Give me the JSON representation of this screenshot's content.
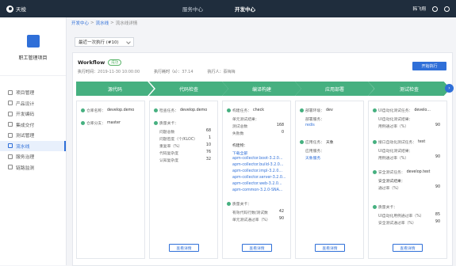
{
  "topbar": {
    "logo": "天梭",
    "nav": [
      "服务中心",
      "开发中心"
    ],
    "user": "韩飞翔"
  },
  "sidebar": {
    "project": "职工管理项目",
    "items": [
      "项目管理",
      "产品设计",
      "开发编码",
      "集成交付",
      "测试管理",
      "流水线",
      "服务治理",
      "链路监测"
    ],
    "active_index": 5
  },
  "breadcrumb": [
    "开发中心",
    "流水线",
    "流水线详情"
  ],
  "select": {
    "value": "最近一次执行 (#10)"
  },
  "workflow": {
    "title": "Workflow",
    "tag": "成功",
    "started_label": "执行时间：",
    "started": "2019-11-30 10:00:00",
    "duration_label": "执行耗时（s）：",
    "duration": "37.14",
    "executor_label": "执行人：",
    "executor": "蔡梅梅",
    "run_button": "开始执行"
  },
  "stages": [
    "源代码",
    "代码检查",
    "编译构建",
    "应用部署",
    "测试检查"
  ],
  "columns": {
    "source": {
      "repo_label": "仓库名称：",
      "repo": "develop.demo",
      "branch_label": "仓库分支：",
      "branch": "master"
    },
    "check": {
      "task_label": "检查任务：",
      "task": "develop.demo",
      "result_label": "质量关卡：",
      "metrics": [
        {
          "label": "问题总数",
          "value": "68"
        },
        {
          "label": "问题密度（个/KLOC）",
          "value": "1"
        },
        {
          "label": "重复率（%）",
          "value": "10"
        },
        {
          "label": "代码复杂度",
          "value": "76"
        },
        {
          "label": "认知复杂度",
          "value": "32"
        }
      ]
    },
    "build": {
      "task_label": "构建任务：",
      "task": "check",
      "ut_label": "单元测试结果：",
      "ut": [
        {
          "label": "测试总数",
          "value": "168"
        },
        {
          "label": "失败数",
          "value": "0"
        }
      ],
      "artifacts_label": "构建物：",
      "artifacts": [
        "下载全部",
        "apm-collector.boot-3.2.0...",
        "apm-collector.build-3.2.0...",
        "apm-collector.impl-3.2.0...",
        "apm-collector.server-3.2.0...",
        "apm-collector.web-3.2.0...",
        "apm-common-3.2.0-SNA..."
      ],
      "gate_label": "质量关卡：",
      "gate": [
        {
          "label": "有效代码行数/测试数",
          "value": "42"
        },
        {
          "label": "单元测试通过率（%）",
          "value": "90"
        }
      ]
    },
    "deploy": {
      "env_label": "部署环境：",
      "env": "dev",
      "svc_label": "部署服务：",
      "svc": "redis",
      "app_label": "应用任务：",
      "app": "天象",
      "app_svc_label": "应用服务：",
      "app_svc": "天象服务"
    },
    "test": {
      "ui_label": "UI自动化测试任务：",
      "ui": "develo...",
      "ui_result_label": "UI自动化测试结果：",
      "ui_rate": {
        "label": "用例通过率（%）",
        "value": "90"
      },
      "api_label": "接口自动化测试任务：",
      "api": "test",
      "api_result_label": "UI自动化测试结果：",
      "api_rate": {
        "label": "用例通过率（%）",
        "value": "90"
      },
      "sec_label": "安全测试任务：",
      "sec": "develop.test",
      "sec_result_label": "安全测试结果：",
      "sec_rate": {
        "label": "通过率（%）",
        "value": "90"
      },
      "gate_label": "质量关卡：",
      "gate": [
        {
          "label": "UI自动化用例通过率（%）",
          "value": "85"
        },
        {
          "label": "安全测试通过率（%）",
          "value": "90"
        }
      ]
    },
    "detail_button": "查看详情"
  },
  "colors": {
    "accent": "#2f6fd8",
    "success": "#46b080",
    "topbar": "#1f2d3d"
  }
}
